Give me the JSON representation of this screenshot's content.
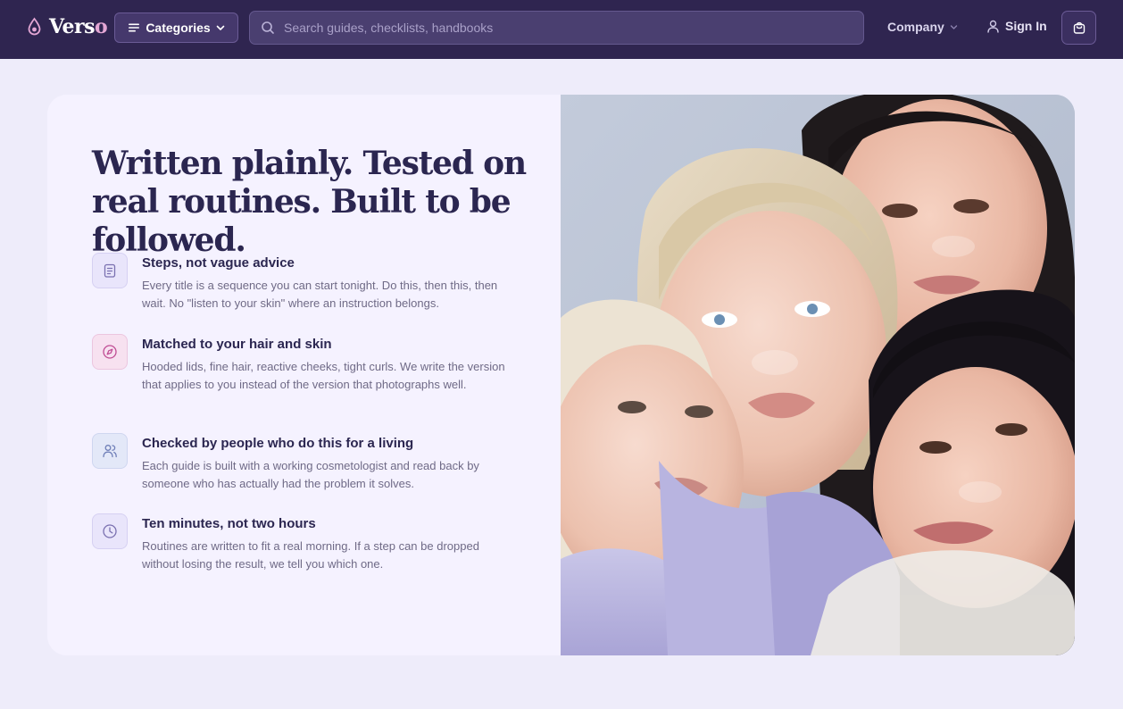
{
  "nav": {
    "brand": {
      "name_main": "Vers",
      "name_accent": "o"
    },
    "categories_label": "Categories",
    "search": {
      "placeholder": "Search guides, checklists, handbooks",
      "value": ""
    },
    "company_label": "Company",
    "signin_label": "Sign In"
  },
  "hero": {
    "headline": "Written plainly. Tested on real routines. Built to be followed.",
    "features": [
      {
        "icon": "clipboard-icon",
        "title": "Steps, not vague advice",
        "description": "Every title is a sequence you can start tonight. Do this, then this, then wait. No \"listen to your skin\" where an instruction belongs."
      },
      {
        "icon": "compass-icon",
        "title": "Matched to your hair and skin",
        "description": "Hooded lids, fine hair, reactive cheeks, tight curls. We write the version that applies to you instead of the version that photographs well."
      },
      {
        "icon": "users-icon",
        "title": "Checked by people who do this for a living",
        "description": "Each guide is built with a working cosmetologist and read back by someone who has actually had the problem it solves."
      },
      {
        "icon": "clock-icon",
        "title": "Ten minutes, not two hours",
        "description": "Routines are written to fit a real morning. If a step can be dropped without losing the result, we tell you which one."
      }
    ]
  },
  "colors": {
    "nav_bg": "#2f2550",
    "page_bg": "#eeecfa",
    "card_bg": "#f5f2ff",
    "heading": "#2b2650",
    "body_text": "#6f6a86",
    "accent_pink": "#e3a6d4"
  }
}
